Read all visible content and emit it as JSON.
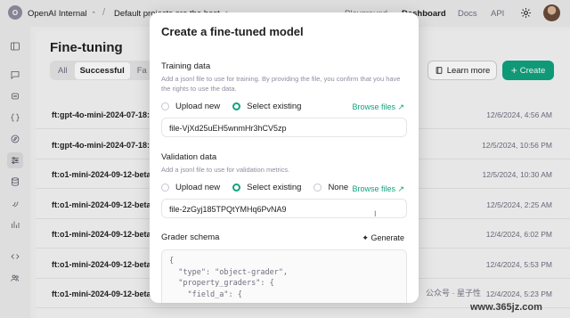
{
  "topbar": {
    "org_initial": "O",
    "org_name": "OpenAI Internal",
    "separator": "/",
    "project_name": "Default projects are the best",
    "chevron": "⌃",
    "nav": [
      {
        "label": "Playground"
      },
      {
        "label": "Dashboard"
      },
      {
        "label": "Docs"
      },
      {
        "label": "API"
      }
    ],
    "active_nav": "Dashboard"
  },
  "sidebar": {
    "icons": [
      "panel-toggle-icon",
      "chat-icon",
      "assistant-icon",
      "braces-icon",
      "compass-icon",
      "sliders-icon",
      "database-icon",
      "audio-icon",
      "bar-chart-icon",
      "code-icon",
      "people-icon"
    ],
    "active": "sliders-icon"
  },
  "main": {
    "title": "Fine-tuning",
    "filters": [
      {
        "label": "All"
      },
      {
        "label": "Successful"
      },
      {
        "label": "Fa"
      }
    ],
    "learn_more": "Learn more",
    "create": "Create",
    "jobs": [
      {
        "name": "ft:gpt-4o-mini-2024-07-18:",
        "date": "12/6/2024, 4:56 AM"
      },
      {
        "name": "ft:gpt-4o-mini-2024-07-18:",
        "date": "12/5/2024, 10:56 PM"
      },
      {
        "name": "ft:o1-mini-2024-09-12-beta:",
        "date": "12/5/2024, 10:30 AM"
      },
      {
        "name": "ft:o1-mini-2024-09-12-beta:",
        "date": "12/5/2024, 2:25 AM"
      },
      {
        "name": "ft:o1-mini-2024-09-12-beta:",
        "date": "12/4/2024, 6:02 PM"
      },
      {
        "name": "ft:o1-mini-2024-09-12-beta:",
        "date": "12/4/2024, 5:53 PM"
      },
      {
        "name": "ft:o1-mini-2024-09-12-beta:",
        "date": "12/4/2024, 5:23 PM"
      }
    ]
  },
  "modal": {
    "title": "Create a fine-tuned model",
    "training": {
      "title": "Training data",
      "desc": "Add a jsonl file to use for training. By providing the file, you confirm that you have the rights to use the data.",
      "options": [
        "Upload new",
        "Select existing"
      ],
      "selected": "Select existing",
      "browse": "Browse files ↗",
      "file": "file-VjXd25uEH5wnmHr3hCV5zp"
    },
    "validation": {
      "title": "Validation data",
      "desc": "Add a jsonl file to use for validation metrics.",
      "options": [
        "Upload new",
        "Select existing",
        "None"
      ],
      "selected": "Select existing",
      "browse": "Browse files ↗",
      "file": "file-2zGyj185TPQtYMHq6PvNA9"
    },
    "grader": {
      "title": "Grader schema",
      "generate": "Generate",
      "code": "{\n  \"type\": \"object-grader\",\n  \"property_graders\": {\n    \"field_a\": {"
    }
  },
  "watermark": {
    "text": "公众号 · 星子性",
    "url": "www.365jz.com"
  },
  "colors": {
    "accent": "#10a37f",
    "text": "#202123",
    "muted": "#8e8ea0"
  }
}
